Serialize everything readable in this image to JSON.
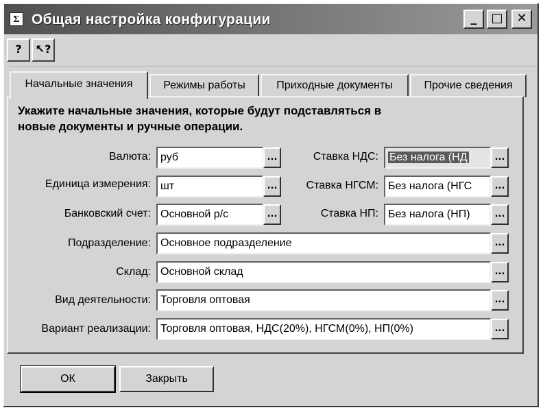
{
  "window": {
    "title": "Общая настройка конфигурации",
    "icon_letter": "Σ"
  },
  "title_buttons": [
    {
      "name": "minimize",
      "glyph": "_"
    },
    {
      "name": "maximize",
      "glyph": "□"
    },
    {
      "name": "close",
      "glyph": "✕"
    }
  ],
  "toolbar": {
    "help_glyph": "?",
    "context_help_glyph": "↖?"
  },
  "tabs": [
    {
      "label": "Начальные значения",
      "active": true
    },
    {
      "label": "Режимы работы",
      "active": false
    },
    {
      "label": "Приходные документы",
      "active": false
    },
    {
      "label": "Прочие сведения",
      "active": false
    }
  ],
  "heading": {
    "line1": "Укажите начальные значения, которые будут подставляться в",
    "line2": "новые документы и ручные операции."
  },
  "fields_left": [
    {
      "label": "Валюта:",
      "value": "руб"
    },
    {
      "label": "Единица измерения:",
      "value": "шт"
    },
    {
      "label": "Банковский счет:",
      "value": "Основной р/с"
    }
  ],
  "fields_right": [
    {
      "label": "Ставка НДС:",
      "value": "Без налога (НД",
      "disabled": true
    },
    {
      "label": "Ставка НГСМ:",
      "value": "Без налога (НГС"
    },
    {
      "label": "Ставка НП:",
      "value": "Без налога (НП)"
    }
  ],
  "fields_wide": [
    {
      "label": "Подразделение:",
      "value": "Основное подразделение"
    },
    {
      "label": "Склад:",
      "value": "Основной склад"
    },
    {
      "label": "Вид деятельности:",
      "value": "Торговля оптовая"
    },
    {
      "label": "Вариант реализации:",
      "value": "Торговля оптовая, НДС(20%), НГСМ(0%), НП(0%)"
    }
  ],
  "choose_button_label": "...",
  "buttons": {
    "ok": "ОК",
    "close": "Закрыть"
  }
}
